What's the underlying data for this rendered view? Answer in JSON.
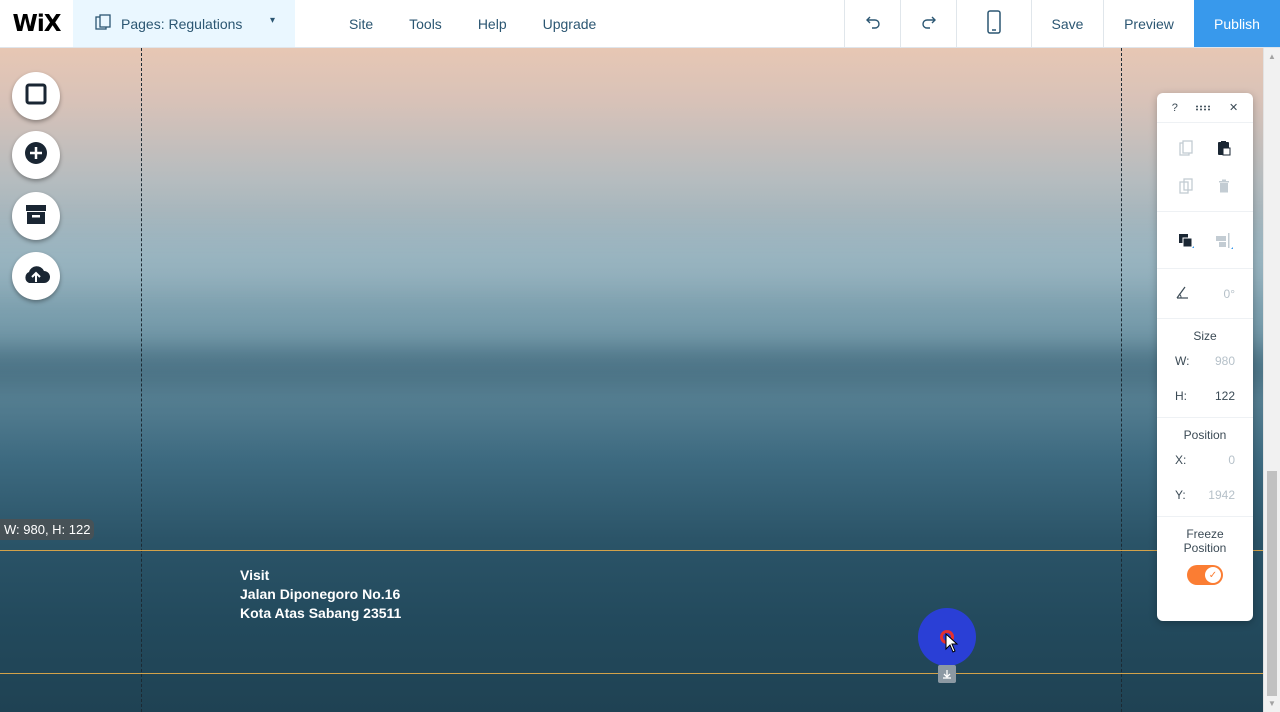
{
  "topbar": {
    "logo": "WiX",
    "pages_label": "Pages: Regulations",
    "menu": [
      "Site",
      "Tools",
      "Help",
      "Upgrade"
    ],
    "save": "Save",
    "preview": "Preview",
    "publish": "Publish"
  },
  "canvas": {
    "size_tip": "W: 980, H: 122",
    "address": [
      "Visit",
      "Jalan Diponegoro No.16",
      "Kota Atas Sabang 23511"
    ]
  },
  "panel": {
    "help": "?",
    "close": "✕",
    "rotation": "0°",
    "size_title": "Size",
    "w_label": "W:",
    "w_value": "980",
    "h_label": "H:",
    "h_value": "122",
    "position_title": "Position",
    "x_label": "X:",
    "x_value": "0",
    "y_label": "Y:",
    "y_value": "1942",
    "freeze_line1": "Freeze",
    "freeze_line2": "Position",
    "freeze_on": true
  },
  "colors": {
    "accent": "#3899ec",
    "toggle": "#fb7d33",
    "guide_line": "#d2a24a"
  }
}
